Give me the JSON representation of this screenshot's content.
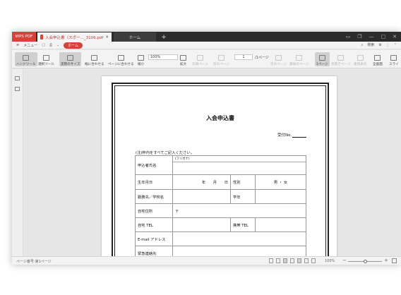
{
  "titlebar": {
    "app_tab": "WPS PDF",
    "doc_tab": "入会申込書（スポー…_3106.pdf",
    "home_tab": "ホーム",
    "new_tab": "+"
  },
  "menubar": {
    "menu_label": "メニュー",
    "home_label": "ホーム",
    "search_label": "検索"
  },
  "toolbar": {
    "hand_tool": "ハンドツール",
    "select_tool": "選択ツール",
    "actual_size": "実際のサイズ",
    "fit_width": "幅に合わせる",
    "fit_page": "ページに合わせる",
    "zoom_out": "縮小",
    "zoom_value": "100%",
    "zoom_in": "拡大",
    "first_page": "先頭ページ",
    "prev_page": "前のページ",
    "page_current": "1",
    "page_total": "/1ページ",
    "next_page": "次のページ",
    "last_page": "最後のページ",
    "single_page": "1ページ",
    "two_pages": "見開きページ",
    "continuous": "連続表示",
    "fullscreen": "全画面",
    "slideshow": "スライ"
  },
  "document": {
    "title": "入会申込書",
    "receipt_label": "受付No.",
    "note": "(注)枠内をすべてご記入ください。",
    "rows": {
      "furigana": "(フリガナ)",
      "name": "申込者氏名",
      "birth": "生年月日",
      "birth_fields": "年　　月　　日",
      "gender": "性別",
      "gender_opts": "男 ・ 女",
      "workplace": "勤務先／学校名",
      "grade": "学年",
      "address": "自宅住所",
      "postal": "〒",
      "home_tel": "自宅 TEL",
      "mobile_tel": "携帯 TEL",
      "email": "E-mail アドレス",
      "emergency": "緊急連絡先"
    }
  },
  "statusbar": {
    "page_info": "ページ番号:第1ページ",
    "zoom": "100%",
    "minus": "−",
    "plus": "+"
  },
  "colors": {
    "accent": "#d6413a",
    "titlebar": "#2c2c2c",
    "toolbar": "#f3f3f3",
    "workspace": "#e6e6e6"
  }
}
